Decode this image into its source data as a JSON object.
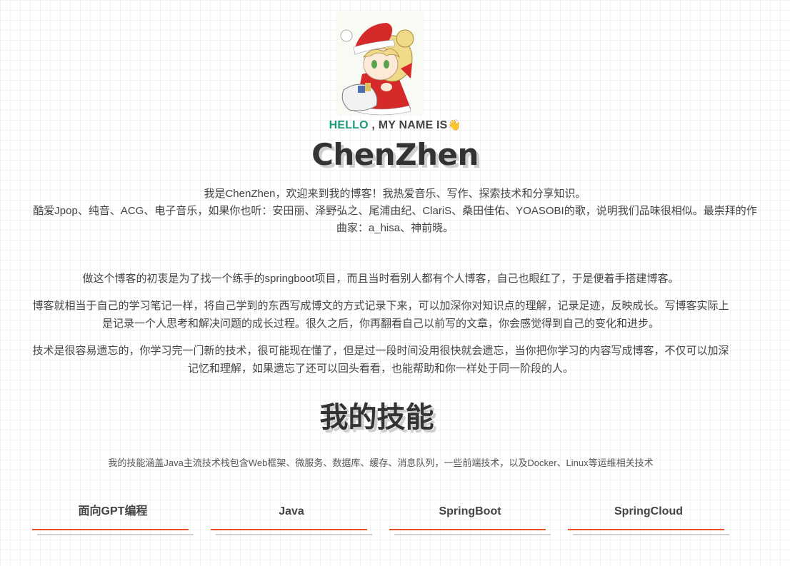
{
  "hero": {
    "hello": "HELLO",
    "rest": " , MY NAME IS",
    "wave": "👋",
    "name": "ChenZhen"
  },
  "intro": {
    "line1": "我是ChenZhen，欢迎来到我的博客！我热爱音乐、写作、探索技术和分享知识。",
    "line2": "酷爱Jpop、纯音、ACG、电子音乐，如果你也听：安田丽、泽野弘之、尾浦由纪、ClariS、桑田佳佑、YOASOBI的歌，说明我们品味很相似。最崇拜的作曲家：a_hisa、神前晓。"
  },
  "about": {
    "p1": "做这个博客的初衷是为了找一个练手的springboot项目，而且当时看别人都有个人博客，自己也眼红了，于是便着手搭建博客。",
    "p2": "博客就相当于自己的学习笔记一样，将自己学到的东西写成博文的方式记录下来，可以加深你对知识点的理解，记录足迹，反映成长。写博客实际上是记录一个人思考和解决问题的成长过程。很久之后，你再翻看自己以前写的文章，你会感觉得到自己的变化和进步。",
    "p3": "技术是很容易遗忘的，你学习完一门新的技术，很可能现在懂了，但是过一段时间没用很快就会遗忘，当你把你学习的内容写成博客，不仅可以加深记忆和理解，如果遗忘了还可以回头看看，也能帮助和你一样处于同一阶段的人。"
  },
  "skills": {
    "title": "我的技能",
    "description": "我的技能涵盖Java主流技术栈包含Web框架、微服务、数据库、缓存、消息队列，一些前端技术，以及Docker、Linux等运维相关技术",
    "items": [
      {
        "label": "面向GPT编程"
      },
      {
        "label": "Java"
      },
      {
        "label": "SpringBoot"
      },
      {
        "label": "SpringCloud"
      }
    ]
  },
  "colors": {
    "accent": "#e8512a",
    "hello": "#1a9a79",
    "text": "#333333"
  }
}
